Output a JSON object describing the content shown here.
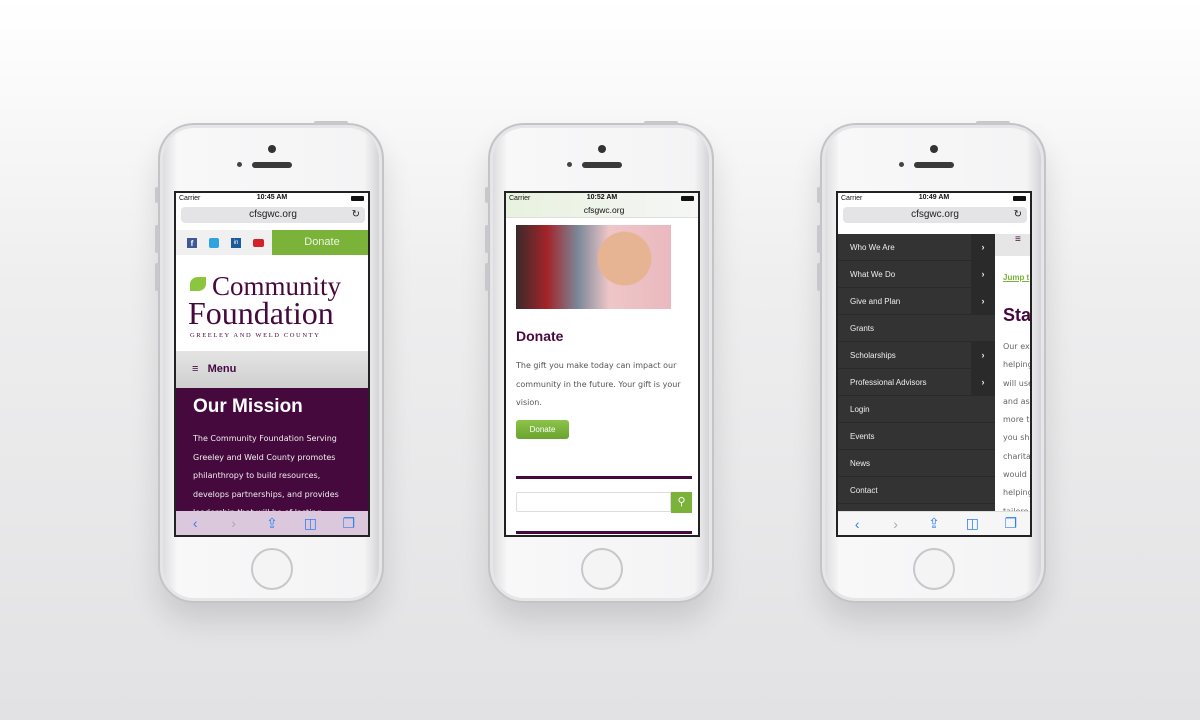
{
  "phones": [
    {
      "carrier": "Carrier",
      "time": "10:45 AM",
      "url": "cfsgwc.org",
      "social": [
        "facebook-icon",
        "twitter-icon",
        "linkedin-icon",
        "youtube-icon"
      ],
      "donate": "Donate",
      "logo": {
        "line1": "Community",
        "line2": "Foundation",
        "line3": "GREELEY AND WELD COUNTY"
      },
      "menu": "Menu",
      "heading": "Our Mission",
      "paragraph": [
        "The Community Foundation Serving",
        "Greeley and Weld County promotes",
        "philanthropy to build resources,",
        "develops partnerships, and provides",
        "leadership that will be of lasting"
      ]
    },
    {
      "carrier": "Carrier",
      "time": "10:52 AM",
      "url": "cfsgwc.org",
      "heading": "Donate",
      "paragraph": [
        "The gift you make today can impact our",
        "community in the future.  Your gift is your",
        "vision."
      ],
      "button": "Donate",
      "search_placeholder": ""
    },
    {
      "carrier": "Carrier",
      "time": "10:49 AM",
      "url": "cfsgwc.org",
      "menu_items": [
        {
          "label": "Who We Are",
          "sub": true
        },
        {
          "label": "What We Do",
          "sub": true
        },
        {
          "label": "Give and Plan",
          "sub": true
        },
        {
          "label": "Grants",
          "sub": false
        },
        {
          "label": "Scholarships",
          "sub": true
        },
        {
          "label": "Professional Advisors",
          "sub": true
        },
        {
          "label": "Login",
          "sub": false
        },
        {
          "label": "Events",
          "sub": false
        },
        {
          "label": "News",
          "sub": false
        },
        {
          "label": "Contact",
          "sub": false
        }
      ],
      "jump": "Jump t",
      "heading": "Sta",
      "paragraph": [
        "Our ex",
        "helping",
        "will use",
        "and ass",
        "more t",
        "you sha",
        "charita",
        "would",
        "helping",
        "tailore"
      ]
    }
  ],
  "colors": {
    "purple": "#45093e",
    "green": "#7ab23a",
    "menu_bg": "#333333"
  }
}
